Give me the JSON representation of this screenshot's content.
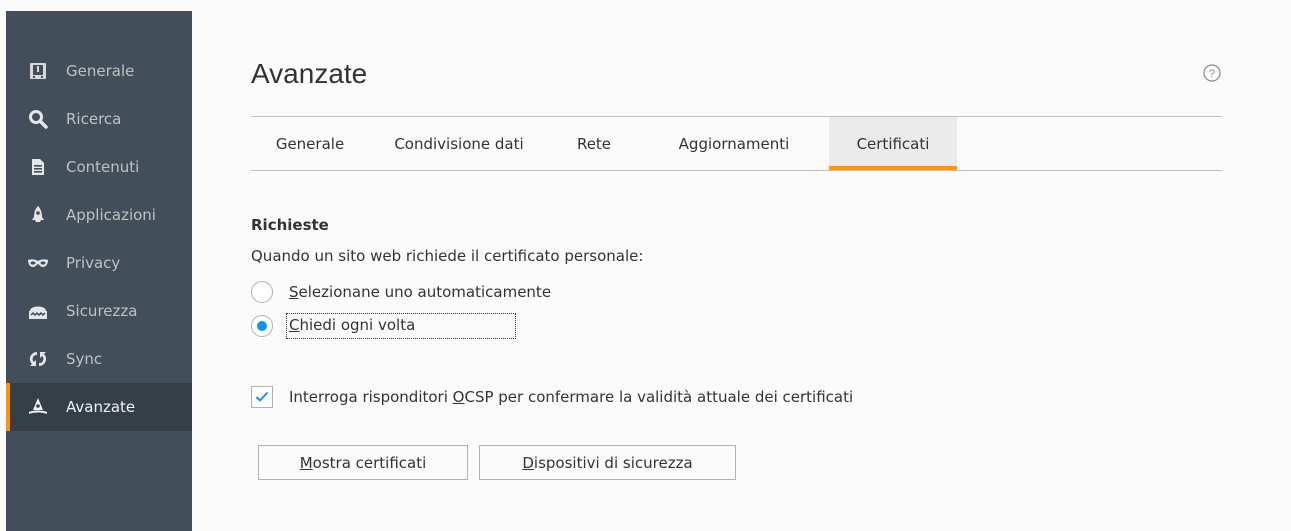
{
  "sidebar": {
    "items": [
      {
        "label": "Generale",
        "icon": "general-icon",
        "active": false
      },
      {
        "label": "Ricerca",
        "icon": "search-icon",
        "active": false
      },
      {
        "label": "Contenuti",
        "icon": "content-icon",
        "active": false
      },
      {
        "label": "Applicazioni",
        "icon": "applications-icon",
        "active": false
      },
      {
        "label": "Privacy",
        "icon": "privacy-mask-icon",
        "active": false
      },
      {
        "label": "Sicurezza",
        "icon": "security-icon",
        "active": false
      },
      {
        "label": "Sync",
        "icon": "sync-icon",
        "active": false
      },
      {
        "label": "Avanzate",
        "icon": "advanced-wizard-hat-icon",
        "active": true
      }
    ]
  },
  "main": {
    "title": "Avanzate",
    "help_icon": "help-icon",
    "tabs": [
      {
        "label": "Generale",
        "selected": false
      },
      {
        "label": "Condivisione dati",
        "selected": false
      },
      {
        "label": "Rete",
        "selected": false
      },
      {
        "label": "Aggiornamenti",
        "selected": false
      },
      {
        "label": "Certificati",
        "selected": true
      }
    ],
    "requests": {
      "heading": "Richieste",
      "question": "Quando un sito web richiede il certificato personale:",
      "options": [
        {
          "access_key": "S",
          "rest": "elezionane uno automaticamente",
          "checked": false
        },
        {
          "access_key": "C",
          "rest": "hiedi ogni volta",
          "checked": true
        }
      ]
    },
    "ocsp": {
      "before": "Interroga risponditori ",
      "access_key": "O",
      "after": "CSP per confermare la validità attuale dei certificati",
      "checked": true
    },
    "buttons": {
      "show_certificates": {
        "access_key": "M",
        "rest": "ostra certificati"
      },
      "security_devices": {
        "access_key": "D",
        "rest": "ispositivi di sicurezza"
      }
    }
  },
  "colors": {
    "sidebar_bg": "#424f5a",
    "sidebar_active_bg": "#343f48",
    "accent": "#ff9500",
    "radio_blue": "#0996f8",
    "check_blue": "#0996f8"
  }
}
